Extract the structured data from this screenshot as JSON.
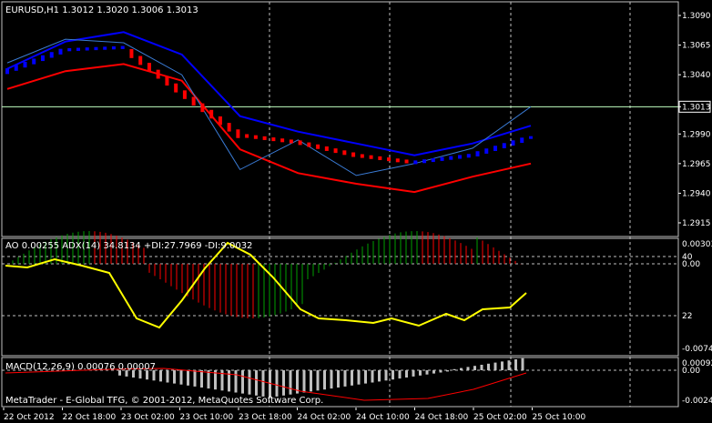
{
  "main_panel": {
    "header": "EURUSD,H1  1.3012 1.3020 1.3006 1.3013",
    "price_labels": [
      "1.3090",
      "1.3065",
      "1.3040",
      "1.3013",
      "1.2990",
      "1.2965",
      "1.2940",
      "1.2915"
    ],
    "current_price": "1.3013"
  },
  "ao_panel": {
    "header": "AO 0.00255  ADX(14) 34.8134 +DI:27.7969 -DI:9.0032",
    "axis_labels": [
      "0.00303",
      "40",
      "0.00",
      "22",
      "-0.00747"
    ]
  },
  "macd_panel": {
    "header": "MACD(12,26,9) 0.00076 0.00007",
    "axis_labels": [
      "0.00092",
      "0.00",
      "-0.00241"
    ]
  },
  "footer": {
    "copyright": "MetaTrader - E-Global TFG, © 2001-2012, MetaQuotes Software Corp."
  },
  "time_axis": [
    "22 Oct 2012",
    "22 Oct 18:00",
    "23 Oct 02:00",
    "23 Oct 10:00",
    "23 Oct 18:00",
    "24 Oct 02:00",
    "24 Oct 10:00",
    "24 Oct 18:00",
    "25 Oct 02:00",
    "25 Oct 10:00"
  ],
  "colors": {
    "background": "#000000",
    "bull_candle": "#0000ff",
    "bear_candle": "#ff0000",
    "upper_band": "#0000ff",
    "lower_band": "#ff0000",
    "price_line": "#3a7bd5",
    "ao_up": "#00a000",
    "ao_down": "#ff0000",
    "adx_line": "#ffff00",
    "macd_hist": "#c0c0c0",
    "macd_signal": "#ff0000",
    "grid": "#c0c0c0",
    "current_price_line": "#c0ffc0"
  },
  "chart_data": {
    "type": "line",
    "symbol_timeframe": "EURUSD,H1",
    "last_bar": {
      "open": 1.3012,
      "high": 1.302,
      "low": 1.3006,
      "close": 1.3013
    },
    "ylim": [
      1.2905,
      1.31
    ],
    "x": [
      "22 Oct 2012",
      "22 Oct 18:00",
      "23 Oct 02:00",
      "23 Oct 10:00",
      "23 Oct 18:00",
      "24 Oct 02:00",
      "24 Oct 10:00",
      "24 Oct 18:00",
      "25 Oct 02:00",
      "25 Oct 10:00"
    ],
    "series": [
      {
        "values": [
          1.3043,
          1.3061,
          1.3063,
          1.3025,
          1.2989,
          1.2983,
          1.2972,
          1.2966,
          1.2972,
          1.2987
        ]
      },
      {
        "values": [
          1.3045,
          1.3068,
          1.3076,
          1.3057,
          1.3005,
          1.2992,
          1.2982,
          1.2972,
          1.2982,
          1.2997
        ]
      },
      {
        "values": [
          1.3028,
          1.3043,
          1.3049,
          1.3035,
          1.2977,
          1.2957,
          1.2948,
          1.2941,
          1.2954,
          1.2965
        ]
      },
      {
        "values": [
          1.305,
          1.307,
          1.3067,
          1.304,
          1.296,
          1.2985,
          1.2955,
          1.2965,
          1.2978,
          1.3013
        ]
      }
    ],
    "grid": true
  }
}
